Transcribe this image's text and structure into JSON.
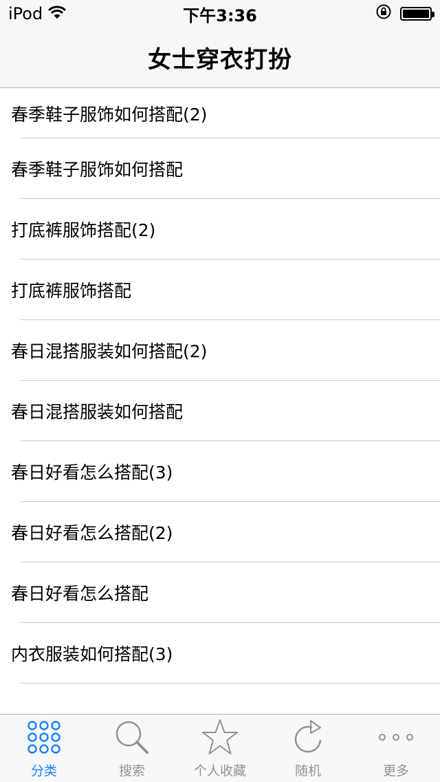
{
  "status_bar": {
    "device": "iPod",
    "time": "下午3:36",
    "battery_level": 1.0
  },
  "nav": {
    "title": "女士穿衣打扮"
  },
  "list": {
    "items": [
      "春季鞋子服饰如何搭配(2)",
      "春季鞋子服饰如何搭配",
      "打底裤服饰搭配(2)",
      "打底裤服饰搭配",
      "春日混搭服装如何搭配(2)",
      "春日混搭服装如何搭配",
      "春日好看怎么搭配(3)",
      "春日好看怎么搭配(2)",
      "春日好看怎么搭配",
      "内衣服装如何搭配(3)"
    ]
  },
  "tab_bar": {
    "active_color": "#1a82fb",
    "inactive_color": "#929292",
    "tabs": [
      {
        "label": "分类",
        "icon": "grid-icon",
        "active": true
      },
      {
        "label": "搜索",
        "icon": "search-icon",
        "active": false
      },
      {
        "label": "个人收藏",
        "icon": "star-icon",
        "active": false
      },
      {
        "label": "随机",
        "icon": "refresh-icon",
        "active": false
      },
      {
        "label": "更多",
        "icon": "more-icon",
        "active": false
      }
    ]
  }
}
